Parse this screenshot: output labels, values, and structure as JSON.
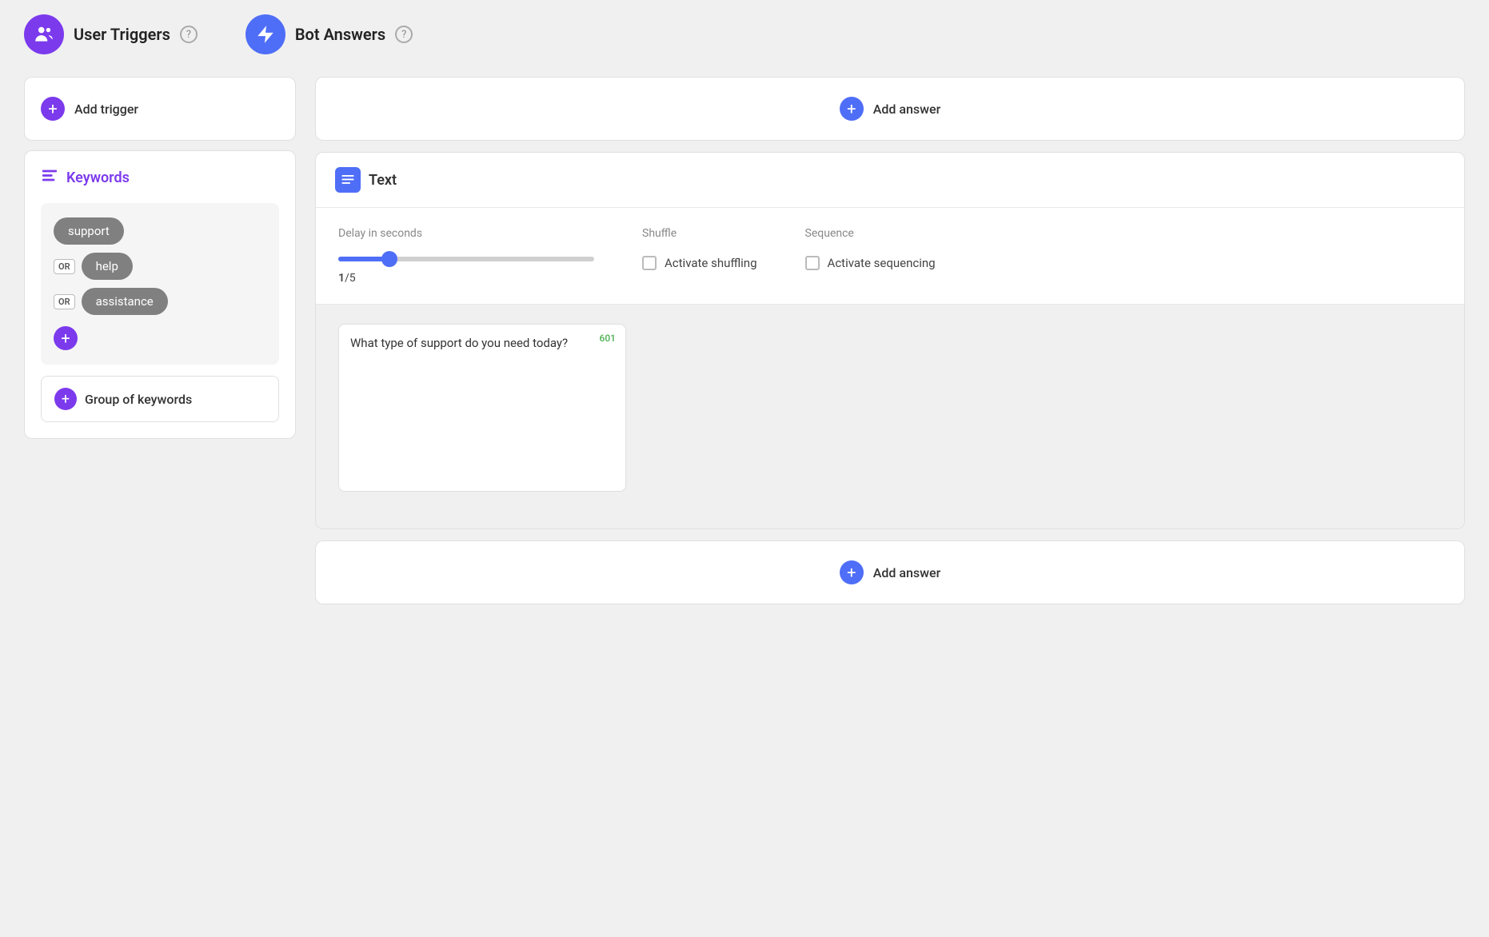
{
  "header": {
    "user_triggers_label": "User Triggers",
    "bot_answers_label": "Bot Answers",
    "help_label": "?"
  },
  "left_panel": {
    "add_trigger_label": "Add trigger",
    "keywords_title": "Keywords",
    "keywords": [
      {
        "text": "support",
        "show_or": false
      },
      {
        "text": "help",
        "show_or": true
      },
      {
        "text": "assistance",
        "show_or": true
      }
    ],
    "group_keywords_label": "Group of keywords"
  },
  "right_panel": {
    "add_answer_top_label": "Add answer",
    "text_section": {
      "title": "Text",
      "delay_label": "Delay in seconds",
      "slider_current": "1",
      "slider_max": "5",
      "slider_display": "1/5",
      "shuffle_label": "Shuffle",
      "shuffle_activate_label": "Activate shuffling",
      "sequence_label": "Sequence",
      "sequence_activate_label": "Activate sequencing",
      "char_count": "601",
      "textarea_value": "What type of support do you need today?"
    },
    "add_answer_bottom_label": "Add answer"
  }
}
